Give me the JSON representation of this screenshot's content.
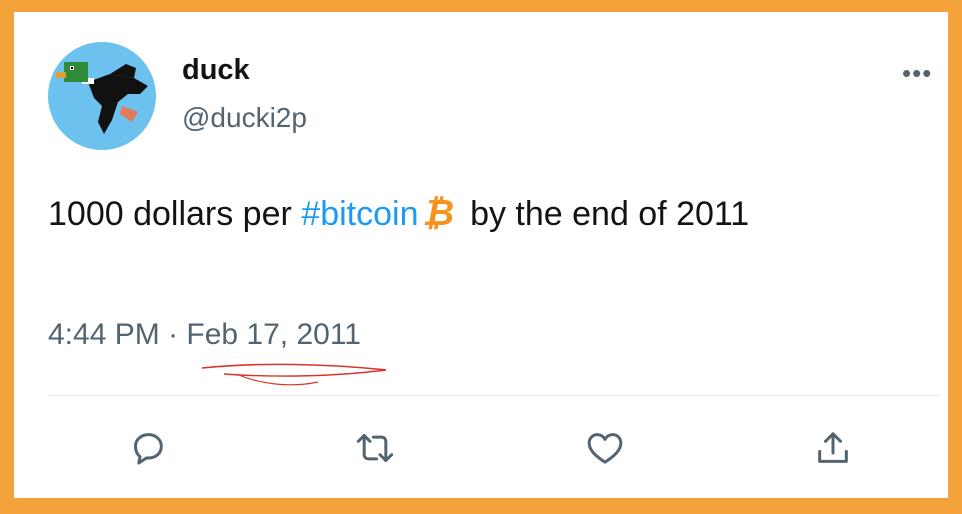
{
  "author": {
    "display_name": "duck",
    "handle": "@ducki2p"
  },
  "menu": {
    "more_label": "•••"
  },
  "tweet": {
    "text_before": "1000 dollars per ",
    "hashtag": "#bitcoin",
    "emoji": "₿",
    "text_after": "by the end of 2011"
  },
  "meta": {
    "time": "4:44 PM",
    "separator": " · ",
    "date": "Feb 17, 2011"
  },
  "actions": [
    {
      "icon": "reply-icon"
    },
    {
      "icon": "retweet-icon"
    },
    {
      "icon": "like-icon"
    },
    {
      "icon": "share-icon"
    }
  ],
  "colors": {
    "frame": "#f4a23a",
    "hashtag": "#1d9bf0",
    "secondary_text": "#536471",
    "bitcoin": "#f7931a",
    "annotation": "#d9342b"
  }
}
